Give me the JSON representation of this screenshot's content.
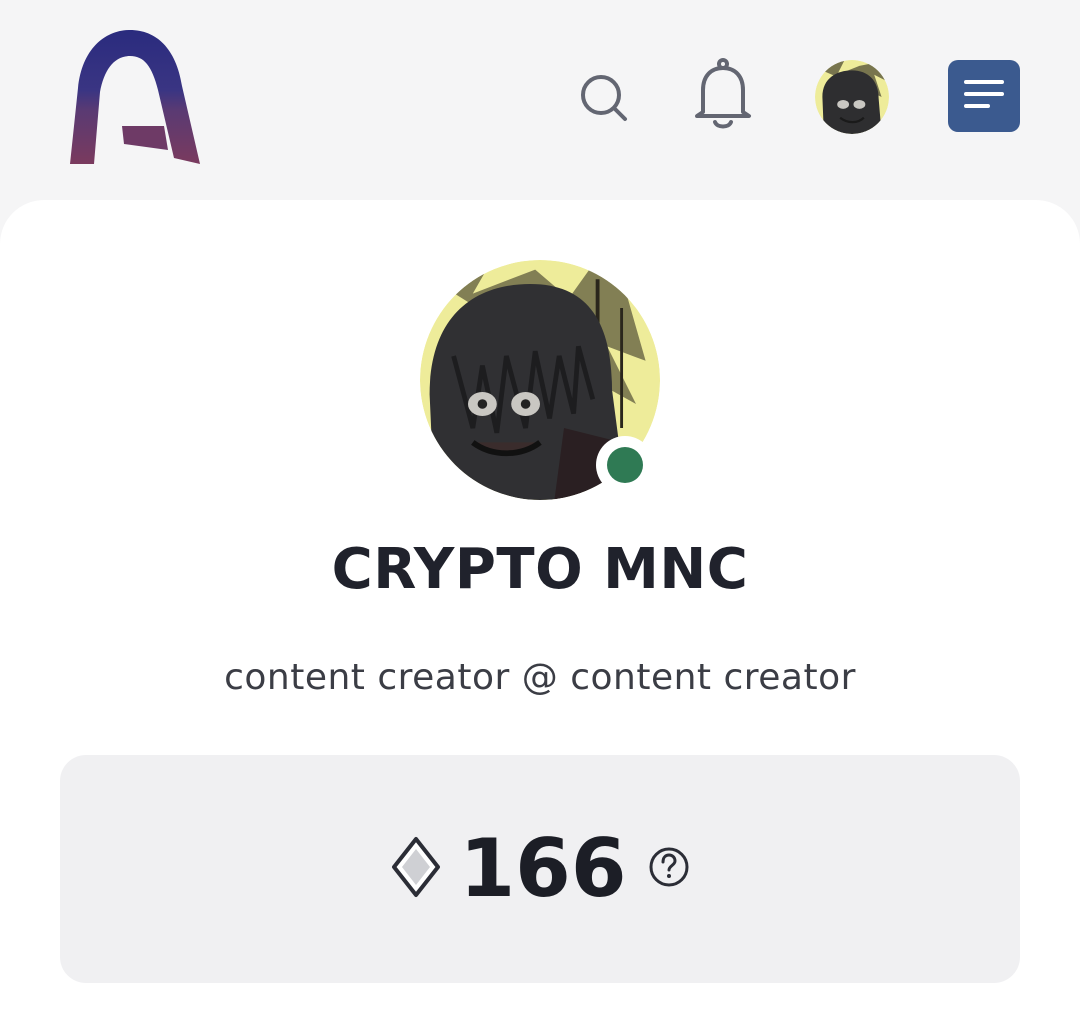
{
  "header": {
    "logo_letter": "A",
    "icons": {
      "search": "search-icon",
      "notifications": "bell-icon",
      "menu": "menu-icon"
    },
    "menu_button_color": "#3b5a8f"
  },
  "profile": {
    "name": "CRYPTO MNC",
    "bio": "content creator @ content creator",
    "status": "online",
    "status_color": "#2f7a54"
  },
  "points": {
    "icon": "diamond-icon",
    "value": "166",
    "help_icon": "question-circle-icon"
  },
  "colors": {
    "background": "#f5f5f6",
    "card": "#ffffff",
    "points_box": "#f0f0f2"
  }
}
